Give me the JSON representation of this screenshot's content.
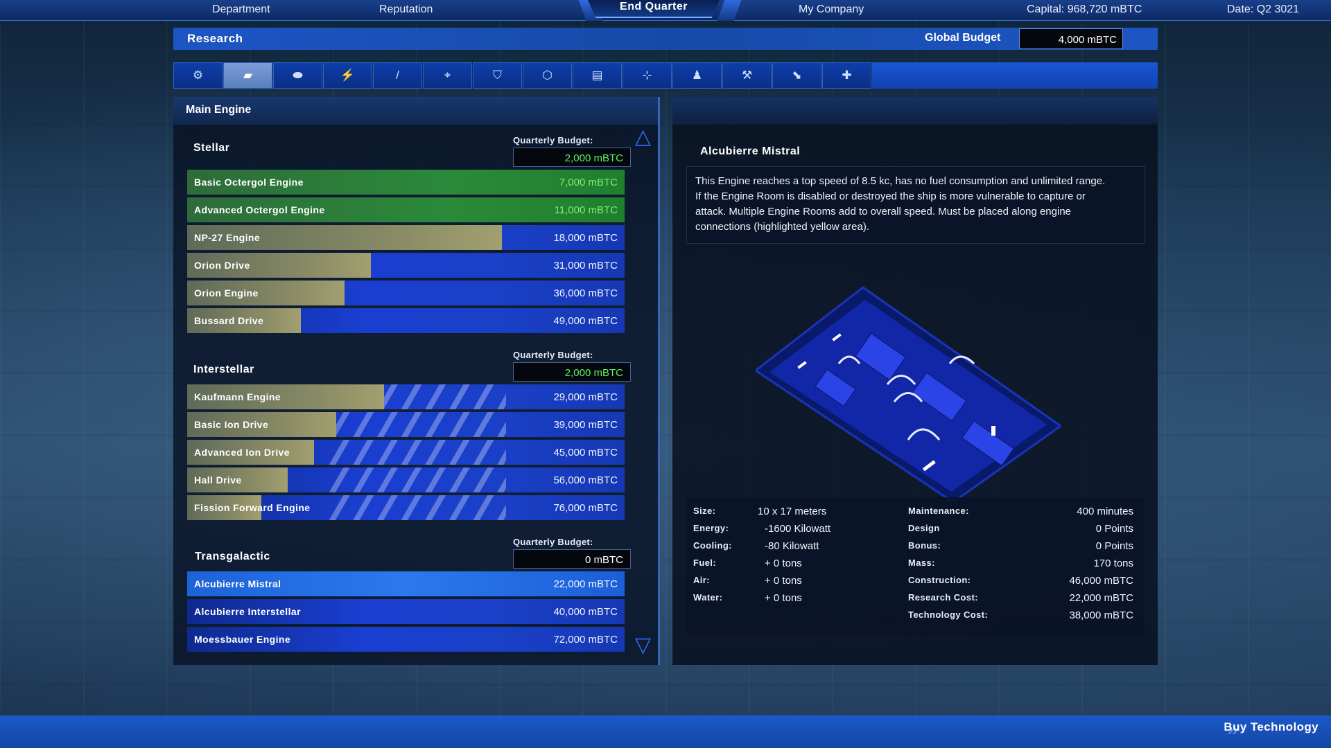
{
  "topbar": {
    "department": "Department",
    "reputation": "Reputation",
    "end_quarter": "End Quarter",
    "my_company": "My Company",
    "capital": "Capital: 968,720 mBTC",
    "date": "Date: Q2 3021"
  },
  "header": {
    "title": "Research",
    "global_budget_label": "Global Budget",
    "global_budget_value": "4,000 mBTC"
  },
  "tabs": [
    {
      "icon": "gear-icon",
      "glyph": "⚙"
    },
    {
      "icon": "engine-icon",
      "glyph": "▰"
    },
    {
      "icon": "thruster-icon",
      "glyph": "⬬"
    },
    {
      "icon": "lightning-icon",
      "glyph": "⚡"
    },
    {
      "icon": "wrench-icon",
      "glyph": "/"
    },
    {
      "icon": "crosshair-icon",
      "glyph": "⌖"
    },
    {
      "icon": "shield-icon",
      "glyph": "⛉"
    },
    {
      "icon": "cube-icon",
      "glyph": "⬡"
    },
    {
      "icon": "server-icon",
      "glyph": "▤"
    },
    {
      "icon": "network-icon",
      "glyph": "⊹"
    },
    {
      "icon": "crew-icon",
      "glyph": "♟"
    },
    {
      "icon": "tools-icon",
      "glyph": "⚒"
    },
    {
      "icon": "tag-icon",
      "glyph": "⬊"
    },
    {
      "icon": "medical-icon",
      "glyph": "✚"
    }
  ],
  "left_panel": {
    "title": "Main Engine",
    "groups": [
      {
        "name": "Stellar",
        "budget_label": "Quarterly Budget:",
        "budget_value": "2,000 mBTC",
        "items": [
          {
            "name": "Basic Octergol Engine",
            "cost": "7,000 mBTC",
            "progress": 1.0,
            "state": "researched"
          },
          {
            "name": "Advanced Octergol Engine",
            "cost": "11,000 mBTC",
            "progress": 1.0,
            "state": "researched"
          },
          {
            "name": "NP-27 Engine",
            "cost": "18,000 mBTC",
            "progress": 0.72,
            "state": "in-progress"
          },
          {
            "name": "Orion Drive",
            "cost": "31,000 mBTC",
            "progress": 0.42,
            "state": "in-progress"
          },
          {
            "name": "Orion Engine",
            "cost": "36,000 mBTC",
            "progress": 0.36,
            "state": "in-progress"
          },
          {
            "name": "Bussard Drive",
            "cost": "49,000 mBTC",
            "progress": 0.26,
            "state": "in-progress"
          }
        ]
      },
      {
        "name": "Interstellar",
        "budget_label": "Quarterly Budget:",
        "budget_value": "2,000 mBTC",
        "items": [
          {
            "name": "Kaufmann Engine",
            "cost": "29,000 mBTC",
            "progress": 0.45,
            "state": "in-progress"
          },
          {
            "name": "Basic Ion Drive",
            "cost": "39,000 mBTC",
            "progress": 0.34,
            "state": "in-progress"
          },
          {
            "name": "Advanced Ion Drive",
            "cost": "45,000 mBTC",
            "progress": 0.29,
            "state": "in-progress"
          },
          {
            "name": "Hall Drive",
            "cost": "56,000 mBTC",
            "progress": 0.23,
            "state": "in-progress"
          },
          {
            "name": "Fission Forward Engine",
            "cost": "76,000 mBTC",
            "progress": 0.17,
            "state": "in-progress"
          }
        ]
      },
      {
        "name": "Transgalactic",
        "budget_label": "Quarterly Budget:",
        "budget_value": "0 mBTC",
        "items": [
          {
            "name": "Alcubierre Mistral",
            "cost": "22,000 mBTC",
            "progress": 0,
            "state": "selected"
          },
          {
            "name": "Alcubierre Interstellar",
            "cost": "40,000 mBTC",
            "progress": 0,
            "state": "locked"
          },
          {
            "name": "Moessbauer Engine",
            "cost": "72,000 mBTC",
            "progress": 0,
            "state": "locked"
          }
        ]
      }
    ]
  },
  "detail": {
    "title": "Alcubierre Mistral",
    "description": "This Engine reaches a top speed of 8.5 kc, has no fuel consumption and unlimited range.\nIf the Engine Room is disabled or destroyed the ship  is more vulnerable to capture or\nattack. Multiple Engine Rooms add to overall speed. Must be placed along engine\nconnections (highlighted yellow area).",
    "stats_left": [
      {
        "label": "Size:",
        "value": "10 x 17 meters"
      },
      {
        "label": "Energy:",
        "value": "-1600 Kilowatt"
      },
      {
        "label": "Cooling:",
        "value": "-80 Kilowatt"
      },
      {
        "label": "Fuel:",
        "value": "+ 0 tons"
      },
      {
        "label": "Air:",
        "value": "+ 0 tons"
      },
      {
        "label": "Water:",
        "value": "+ 0 tons"
      }
    ],
    "stats_right": [
      {
        "label": "Maintenance:",
        "value": "400  minutes"
      },
      {
        "label": "Design",
        "value": "0 Points"
      },
      {
        "label": "Bonus:",
        "value": "0 Points"
      },
      {
        "label": "Mass:",
        "value": "170 tons"
      },
      {
        "label": "Construction:",
        "value": "46,000 mBTC"
      },
      {
        "label": "Research Cost:",
        "value": "22,000 mBTC"
      },
      {
        "label": "Technology Cost:",
        "value": "38,000 mBTC"
      }
    ]
  },
  "footer": {
    "buy_label": "Buy Technology"
  },
  "colors": {
    "accent": "#1d55c4",
    "researched": "#2a8a3a",
    "budget_text": "#5ef25a",
    "selected": "#2c78ef"
  }
}
